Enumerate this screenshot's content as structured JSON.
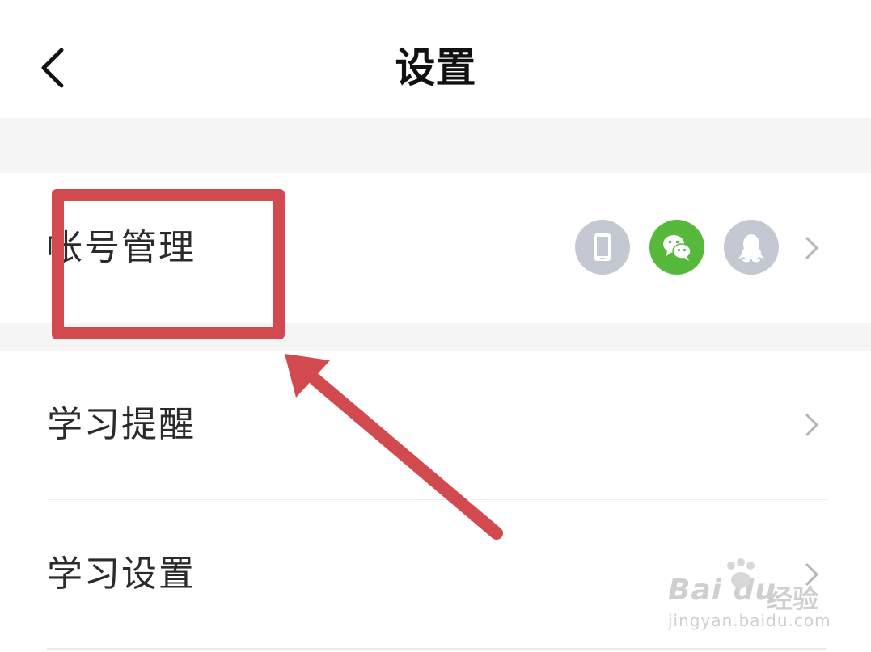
{
  "header": {
    "title": "设置"
  },
  "rows": [
    {
      "label": "帐号管理"
    },
    {
      "label": "学习提醒"
    },
    {
      "label": "学习设置"
    }
  ],
  "account_bindings": [
    {
      "icon": "phone-icon",
      "color": "#c4c8d2"
    },
    {
      "icon": "wechat-icon",
      "color": "#57b93c"
    },
    {
      "icon": "qq-icon",
      "color": "#c4c8d2"
    }
  ],
  "annotation": {
    "color": "#d24a4f"
  },
  "watermark": {
    "logo": "Bai du",
    "cn": "经验",
    "url": "jingyan.baidu.com"
  }
}
